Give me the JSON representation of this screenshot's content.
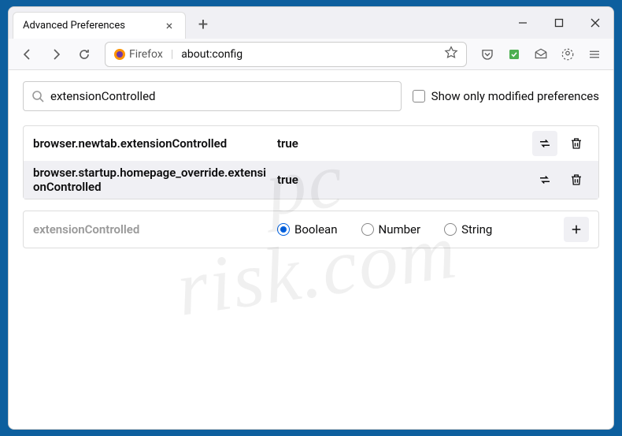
{
  "tab": {
    "title": "Advanced Preferences"
  },
  "urlbar": {
    "identity": "Firefox",
    "url": "about:config"
  },
  "search": {
    "value": "extensionControlled",
    "filter_label": "Show only modified preferences"
  },
  "prefs": [
    {
      "name": "browser.newtab.extensionControlled",
      "value": "true"
    },
    {
      "name": "browser.startup.homepage_override.extensionControlled",
      "value": "true"
    }
  ],
  "creator": {
    "name": "extensionControlled",
    "types": {
      "boolean": "Boolean",
      "number": "Number",
      "string": "String"
    }
  },
  "watermark": {
    "line1": "pc",
    "line2": "risk.com"
  }
}
